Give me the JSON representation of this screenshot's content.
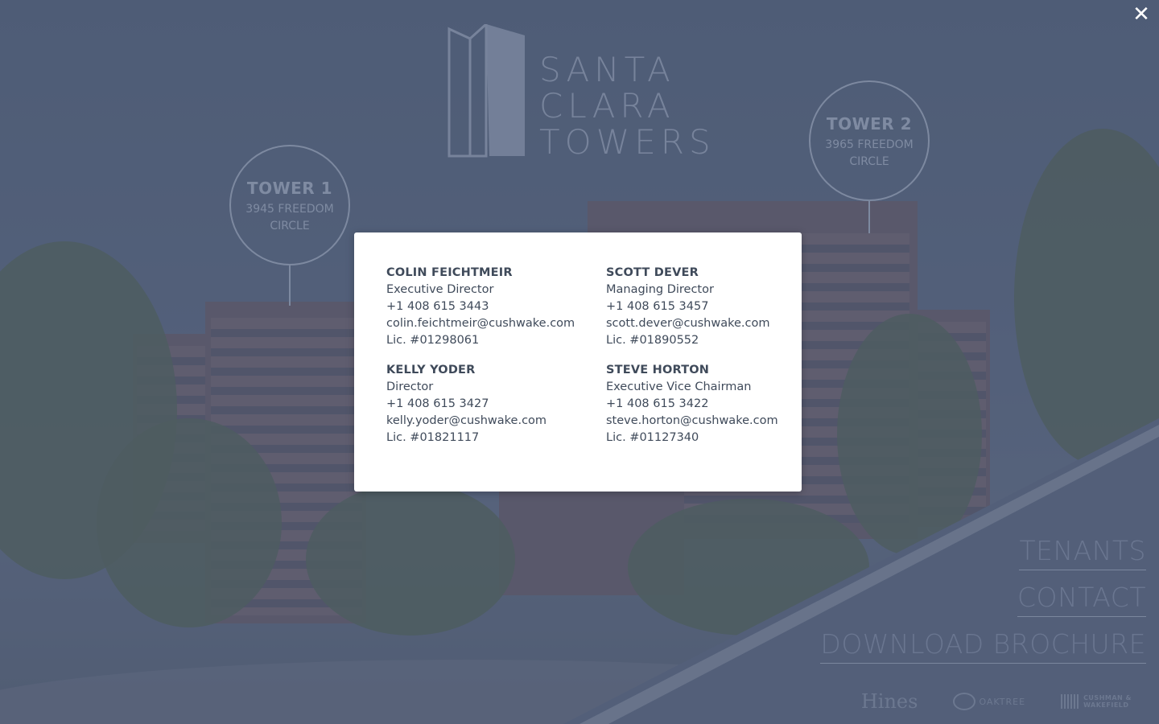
{
  "logo": {
    "lines": [
      "SANTA",
      "CLARA",
      "TOWERS"
    ]
  },
  "towers": [
    {
      "name": "TOWER 1",
      "address_line1": "3945 FREEDOM",
      "address_line2": "CIRCLE"
    },
    {
      "name": "TOWER 2",
      "address_line1": "3965 FREEDOM",
      "address_line2": "CIRCLE"
    }
  ],
  "nav": {
    "tenants": "TENANTS",
    "contact": "CONTACT",
    "download": "DOWNLOAD BROCHURE"
  },
  "partners": {
    "hines": "Hines",
    "oaktree": "OAKTREE",
    "cw_line1": "CUSHMAN &",
    "cw_line2": "WAKEFIELD"
  },
  "close": {
    "icon": "close-icon",
    "glyph": "✕"
  },
  "contacts": [
    {
      "name": "COLIN FEICHTMEIR",
      "title": "Executive Director",
      "phone": "+1 408 615 3443",
      "email": "colin.feichtmeir@cushwake.com",
      "license": "Lic. #01298061"
    },
    {
      "name": "SCOTT DEVER",
      "title": "Managing Director",
      "phone": "+1 408 615 3457",
      "email": "scott.dever@cushwake.com",
      "license": "Lic. #01890552"
    },
    {
      "name": "KELLY YODER",
      "title": "Director",
      "phone": "+1 408 615 3427",
      "email": "kelly.yoder@cushwake.com",
      "license": "Lic. #01821117"
    },
    {
      "name": "STEVE HORTON",
      "title": "Executive Vice Chairman",
      "phone": "+1 408 615 3422",
      "email": "steve.horton@cushwake.com",
      "license": "Lic. #01127340"
    }
  ],
  "colors": {
    "overlay": "#485670",
    "modal_bg": "#ffffff",
    "text": "#3f4a5a"
  }
}
